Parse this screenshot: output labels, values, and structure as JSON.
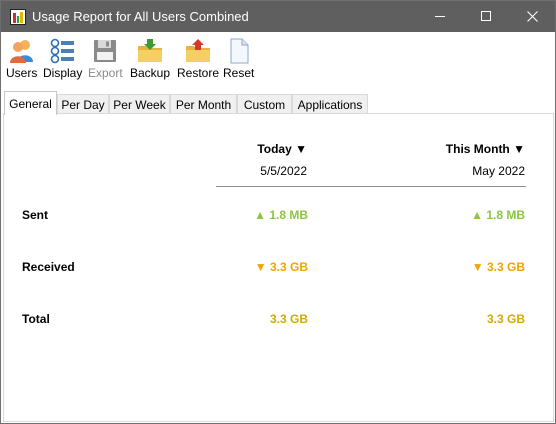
{
  "window": {
    "title": "Usage Report for All Users Combined",
    "controls": {
      "minimize": "—",
      "maximize": "☐",
      "close": "✕"
    }
  },
  "toolbar": {
    "buttons": [
      {
        "label": "Users",
        "icon": "users-icon",
        "enabled": true
      },
      {
        "label": "Display",
        "icon": "display-list-icon",
        "enabled": true
      },
      {
        "label": "Export",
        "icon": "floppy-disk-icon",
        "enabled": false
      },
      {
        "label": "Backup",
        "icon": "folder-download-icon",
        "enabled": true
      },
      {
        "label": "Restore",
        "icon": "folder-upload-icon",
        "enabled": true
      },
      {
        "label": "Reset",
        "icon": "blank-document-icon",
        "enabled": true
      }
    ]
  },
  "tabs": [
    {
      "label": "General",
      "active": true
    },
    {
      "label": "Per Day",
      "active": false
    },
    {
      "label": "Per Week",
      "active": false
    },
    {
      "label": "Per Month",
      "active": false
    },
    {
      "label": "Custom",
      "active": false
    },
    {
      "label": "Applications",
      "active": false
    }
  ],
  "report": {
    "columns": [
      {
        "title": "Today",
        "arrow": "▼",
        "subtitle": "5/5/2022"
      },
      {
        "title": "This Month",
        "arrow": "▼",
        "subtitle": "May 2022"
      }
    ],
    "rows": [
      {
        "label": "Sent",
        "today": "▲ 1.8 MB",
        "month": "▲ 1.8 MB",
        "trend": "up"
      },
      {
        "label": "Received",
        "today": "▼ 3.3 GB",
        "month": "▼ 3.3 GB",
        "trend": "down"
      },
      {
        "label": "Total",
        "today": "3.3 GB",
        "month": "3.3 GB",
        "trend": "total"
      }
    ]
  },
  "colors": {
    "titlebar": "#5f5f5f",
    "sent": "#8cc63f",
    "received": "#f0a500",
    "total": "#d4a900"
  }
}
